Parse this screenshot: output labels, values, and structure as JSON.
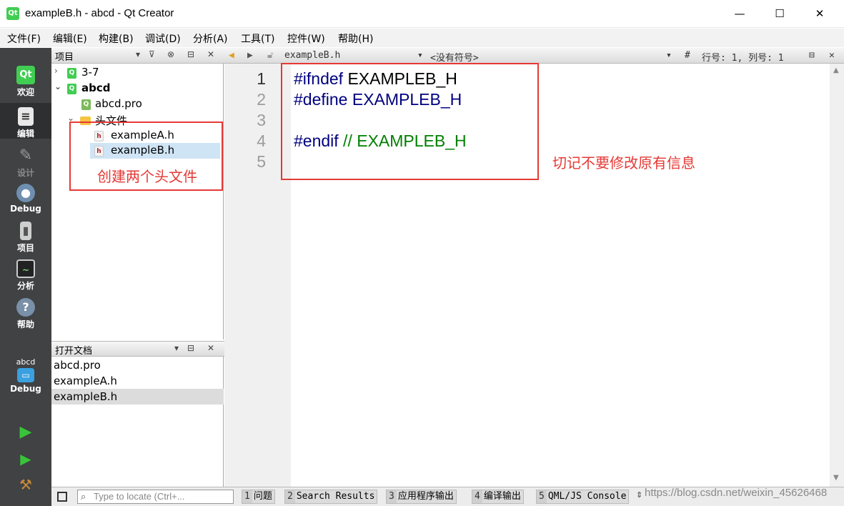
{
  "window": {
    "title": "exampleB.h - abcd - Qt Creator",
    "app_icon": "Qt",
    "controls": {
      "minimize": "—",
      "maximize": "☐",
      "close": "✕"
    }
  },
  "menubar": [
    "文件(F)",
    "编辑(E)",
    "构建(B)",
    "调试(D)",
    "分析(A)",
    "工具(T)",
    "控件(W)",
    "帮助(H)"
  ],
  "modes": [
    {
      "label": "欢迎",
      "icon": "qt-welcome-icon"
    },
    {
      "label": "编辑",
      "icon": "edit-document-icon",
      "active": true
    },
    {
      "label": "设计",
      "icon": "design-tools-icon",
      "dim": true
    },
    {
      "label": "Debug",
      "icon": "debug-bug-icon"
    },
    {
      "label": "项目",
      "icon": "project-folder-icon"
    },
    {
      "label": "分析",
      "icon": "analyze-monitor-icon"
    },
    {
      "label": "帮助",
      "icon": "help-question-icon"
    }
  ],
  "kit": {
    "project": "abcd",
    "config": "Debug"
  },
  "project_pane": {
    "title": "项目",
    "tree": [
      {
        "label": "3-7",
        "level": 0,
        "arrow": "›",
        "icon": "qt-project-icon"
      },
      {
        "label": "abcd",
        "level": 0,
        "arrow": "⌄",
        "icon": "qt-project-icon",
        "bold": true
      },
      {
        "label": "abcd.pro",
        "level": 1,
        "icon": "pro-file-icon"
      },
      {
        "label": "头文件",
        "level": 1,
        "arrow": "⌄",
        "icon": "folder-icon"
      },
      {
        "label": "exampleA.h",
        "level": 2,
        "icon": "header-file-icon"
      },
      {
        "label": "exampleB.h",
        "level": 2,
        "icon": "header-file-icon",
        "selected": true
      }
    ]
  },
  "open_docs": {
    "title": "打开文档",
    "items": [
      {
        "label": "abcd.pro"
      },
      {
        "label": "exampleA.h"
      },
      {
        "label": "exampleB.h",
        "selected": true
      }
    ]
  },
  "editor_toolbar": {
    "file": "exampleB.h",
    "symbol": "<没有符号>",
    "hash": "#",
    "position": "行号: 1, 列号: 1"
  },
  "editor": {
    "line_numbers": [
      "1",
      "2",
      "3",
      "4",
      "5"
    ],
    "lines": [
      {
        "kw": "#ifndef",
        "rest": " EXAMPLEB_H",
        "rest_class": "macro"
      },
      {
        "kw": "#define",
        "rest": " EXAMPLEB_H",
        "rest_class": "kw"
      },
      {
        "kw": "",
        "rest": ""
      },
      {
        "kw": "#endif",
        "rest": " // EXAMPLEB_H",
        "rest_class": "cmt"
      },
      {
        "kw": "",
        "rest": ""
      }
    ]
  },
  "annotations": {
    "left": "创建两个头文件",
    "right": "切记不要修改原有信息",
    "color": "#e53935"
  },
  "statusbar": {
    "locator_placeholder": "Type to locate (Ctrl+...",
    "tabs": [
      {
        "num": "1",
        "label": "问题"
      },
      {
        "num": "2",
        "label": "Search Results"
      },
      {
        "num": "3",
        "label": "应用程序输出"
      },
      {
        "num": "4",
        "label": "编译输出"
      },
      {
        "num": "5",
        "label": "QML/JS Console"
      }
    ]
  },
  "watermark": "https://blog.csdn.net/weixin_45626468"
}
